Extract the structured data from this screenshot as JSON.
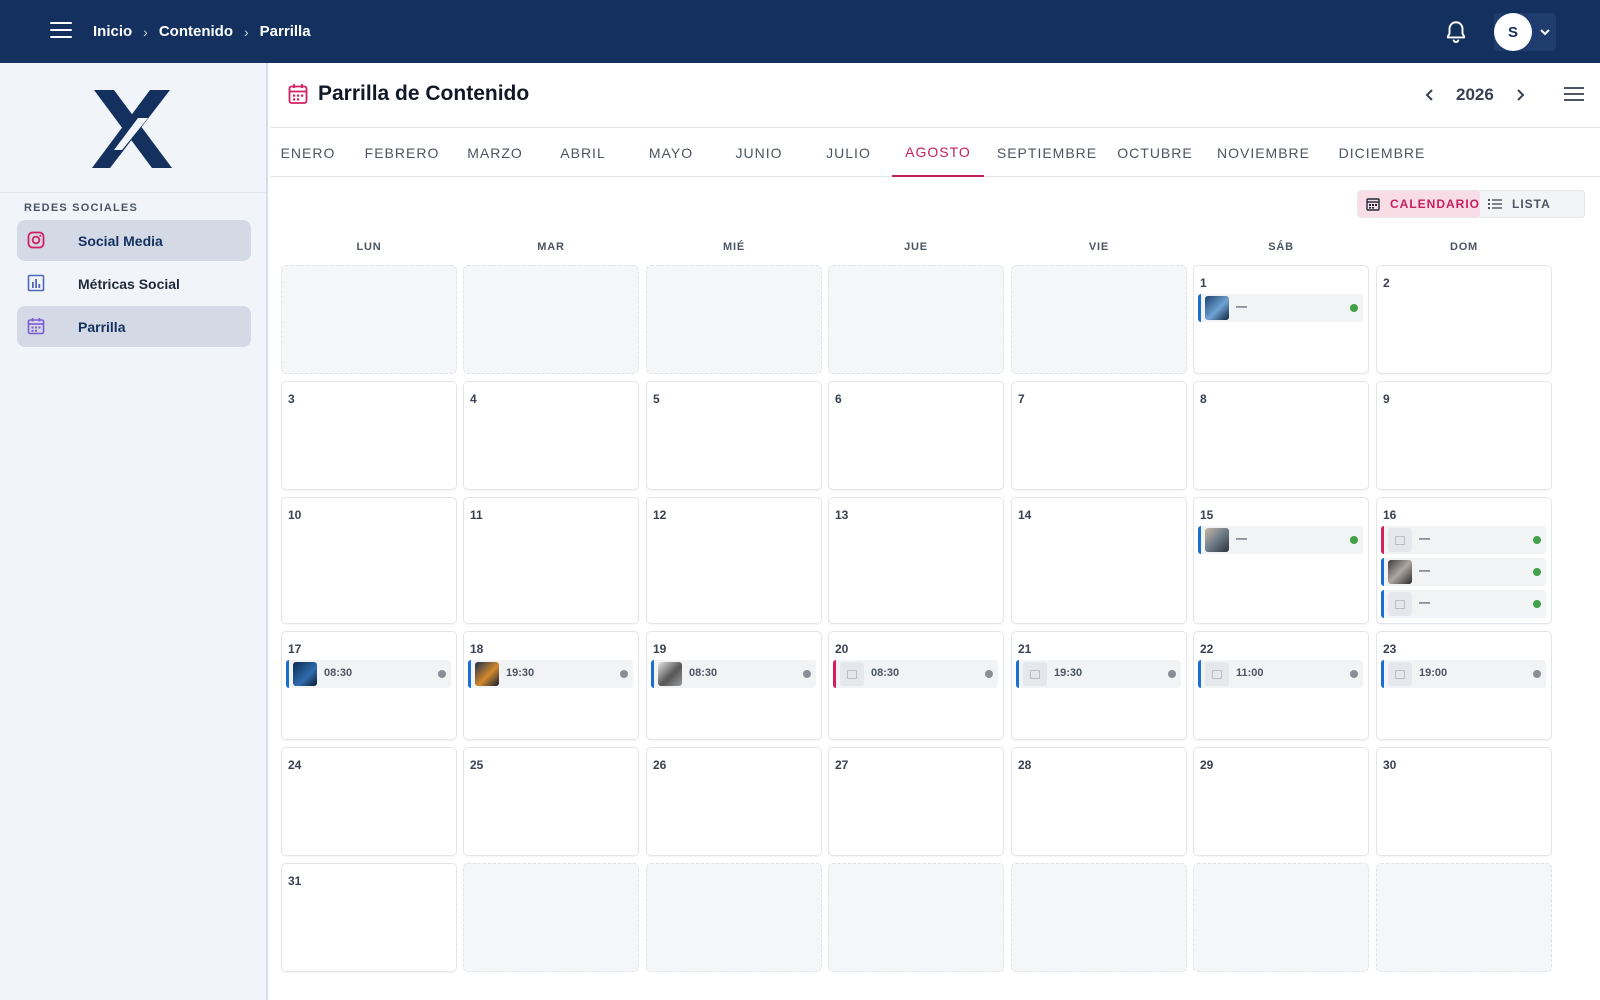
{
  "breadcrumb": [
    "Inicio",
    "Contenido",
    "Parrilla"
  ],
  "user": {
    "initial": "S"
  },
  "sidebar": {
    "section_title": "REDES SOCIALES",
    "items": [
      {
        "label": "Social Media",
        "icon": "instagram-icon",
        "active": true
      },
      {
        "label": "Métricas Social",
        "icon": "bar-chart-icon",
        "active": false
      },
      {
        "label": "Parrilla",
        "icon": "calendar-icon",
        "active": true
      }
    ]
  },
  "header": {
    "title": "Parrilla de Contenido",
    "year": "2026"
  },
  "months": [
    "ENERO",
    "FEBRERO",
    "MARZO",
    "ABRIL",
    "MAYO",
    "JUNIO",
    "JULIO",
    "AGOSTO",
    "SEPTIEMBRE",
    "OCTUBRE",
    "NOVIEMBRE",
    "DICIEMBRE"
  ],
  "active_month": "AGOSTO",
  "view_toggle": {
    "calendar_label": "CALENDARIO",
    "list_label": "LISTA",
    "selected": "calendar"
  },
  "weekdays": [
    "LUN",
    "MAR",
    "MIÉ",
    "JUE",
    "VIE",
    "SÁB",
    "DOM"
  ],
  "colors": {
    "topbar": "#13305f",
    "accent": "#c51f5d",
    "post_blue": "#1b6fd4",
    "post_pink": "#d31e5f",
    "status_green": "#43a047",
    "status_gray": "#8a8f96"
  },
  "posts": [
    {
      "day": 1,
      "label": "—",
      "platform": "blue",
      "thumb": "image",
      "status": "green"
    },
    {
      "day": 15,
      "label": "—",
      "platform": "blue",
      "thumb": "image",
      "status": "green"
    },
    {
      "day": 16,
      "label": "—",
      "platform": "pink",
      "thumb": "placeholder",
      "status": "green"
    },
    {
      "day": 16,
      "label": "—",
      "platform": "blue",
      "thumb": "image",
      "status": "green"
    },
    {
      "day": 16,
      "label": "—",
      "platform": "blue",
      "thumb": "placeholder",
      "status": "green"
    },
    {
      "day": 17,
      "label": "08:30",
      "platform": "blue",
      "thumb": "image",
      "status": "gray"
    },
    {
      "day": 18,
      "label": "19:30",
      "platform": "blue",
      "thumb": "image",
      "status": "gray"
    },
    {
      "day": 19,
      "label": "08:30",
      "platform": "blue",
      "thumb": "image",
      "status": "gray"
    },
    {
      "day": 20,
      "label": "08:30",
      "platform": "pink",
      "thumb": "placeholder",
      "status": "gray"
    },
    {
      "day": 21,
      "label": "19:30",
      "platform": "blue",
      "thumb": "placeholder",
      "status": "gray"
    },
    {
      "day": 22,
      "label": "11:00",
      "platform": "blue",
      "thumb": "placeholder",
      "status": "gray"
    },
    {
      "day": 23,
      "label": "19:00",
      "platform": "blue",
      "thumb": "placeholder",
      "status": "gray"
    }
  ]
}
